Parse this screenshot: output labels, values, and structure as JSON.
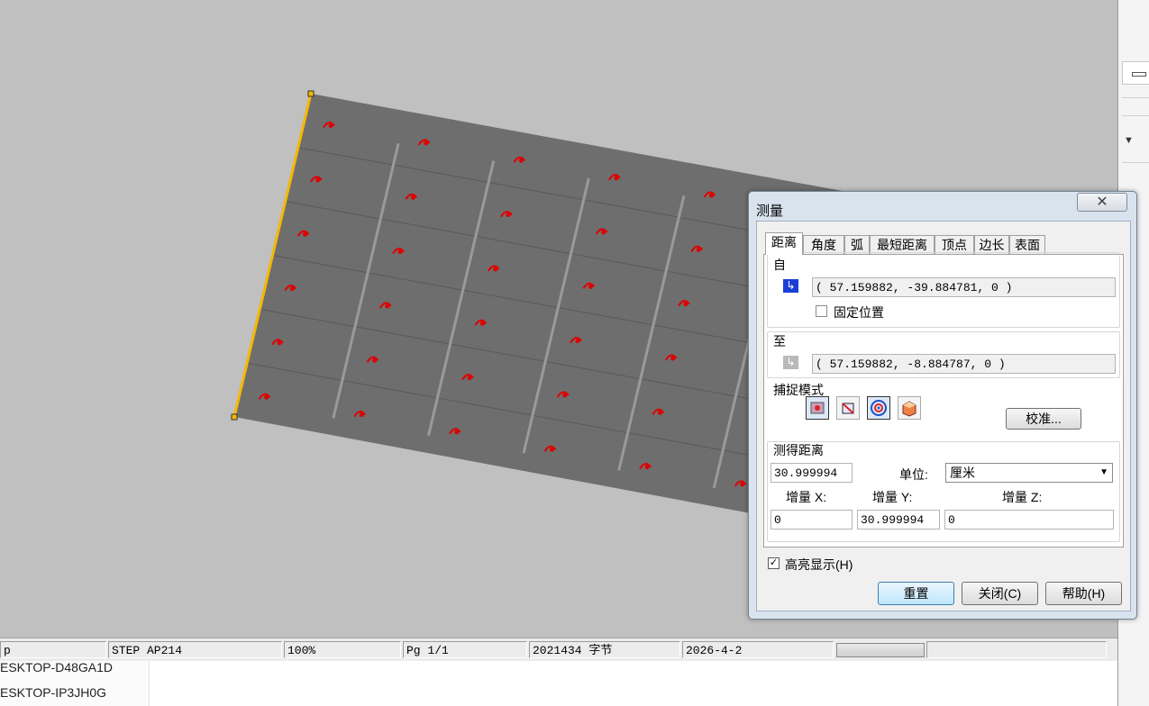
{
  "viewport": {
    "background_color": "#c0c0c0",
    "part_color": "#6e6e6e",
    "highlight_color": "#f5b800",
    "marker_color": "#e00000"
  },
  "status_bar": {
    "cell0": "p",
    "format": "STEP AP214",
    "zoom": "100%",
    "page": "Pg 1/1",
    "size": "2021434 字节",
    "date": "2026-4-2"
  },
  "taskbar": {
    "item1": "ESKTOP-D48GA1D",
    "item2": "ESKTOP-IP3JH0G"
  },
  "dialog": {
    "title": "测量",
    "close_icon": "close-x-icon",
    "tabs": [
      "距离",
      "角度",
      "弧",
      "最短距离",
      "顶点",
      "边长",
      "表面"
    ],
    "active_tab": "距离",
    "from": {
      "label": "自",
      "value": "( 57.159882, -39.884781, 0 )",
      "fixed_label": "固定位置",
      "fixed_checked": false
    },
    "to": {
      "label": "至",
      "value": "( 57.159882, -8.884787, 0 )"
    },
    "snap": {
      "label": "捕捉模式",
      "active_index": 2
    },
    "calibrate_button": "校准...",
    "measured": {
      "label": "测得距离",
      "value": "30.999994",
      "unit_label": "单位:",
      "unit_value": "厘米",
      "dx_label": "增量 X:",
      "dy_label": "增量 Y:",
      "dz_label": "增量 Z:",
      "dx": "0",
      "dy": "30.999994",
      "dz": "0"
    },
    "highlight": {
      "label": "高亮显示(H)",
      "checked": true
    },
    "buttons": {
      "reset": "重置",
      "close": "关闭(C)",
      "help": "帮助(H)"
    }
  }
}
